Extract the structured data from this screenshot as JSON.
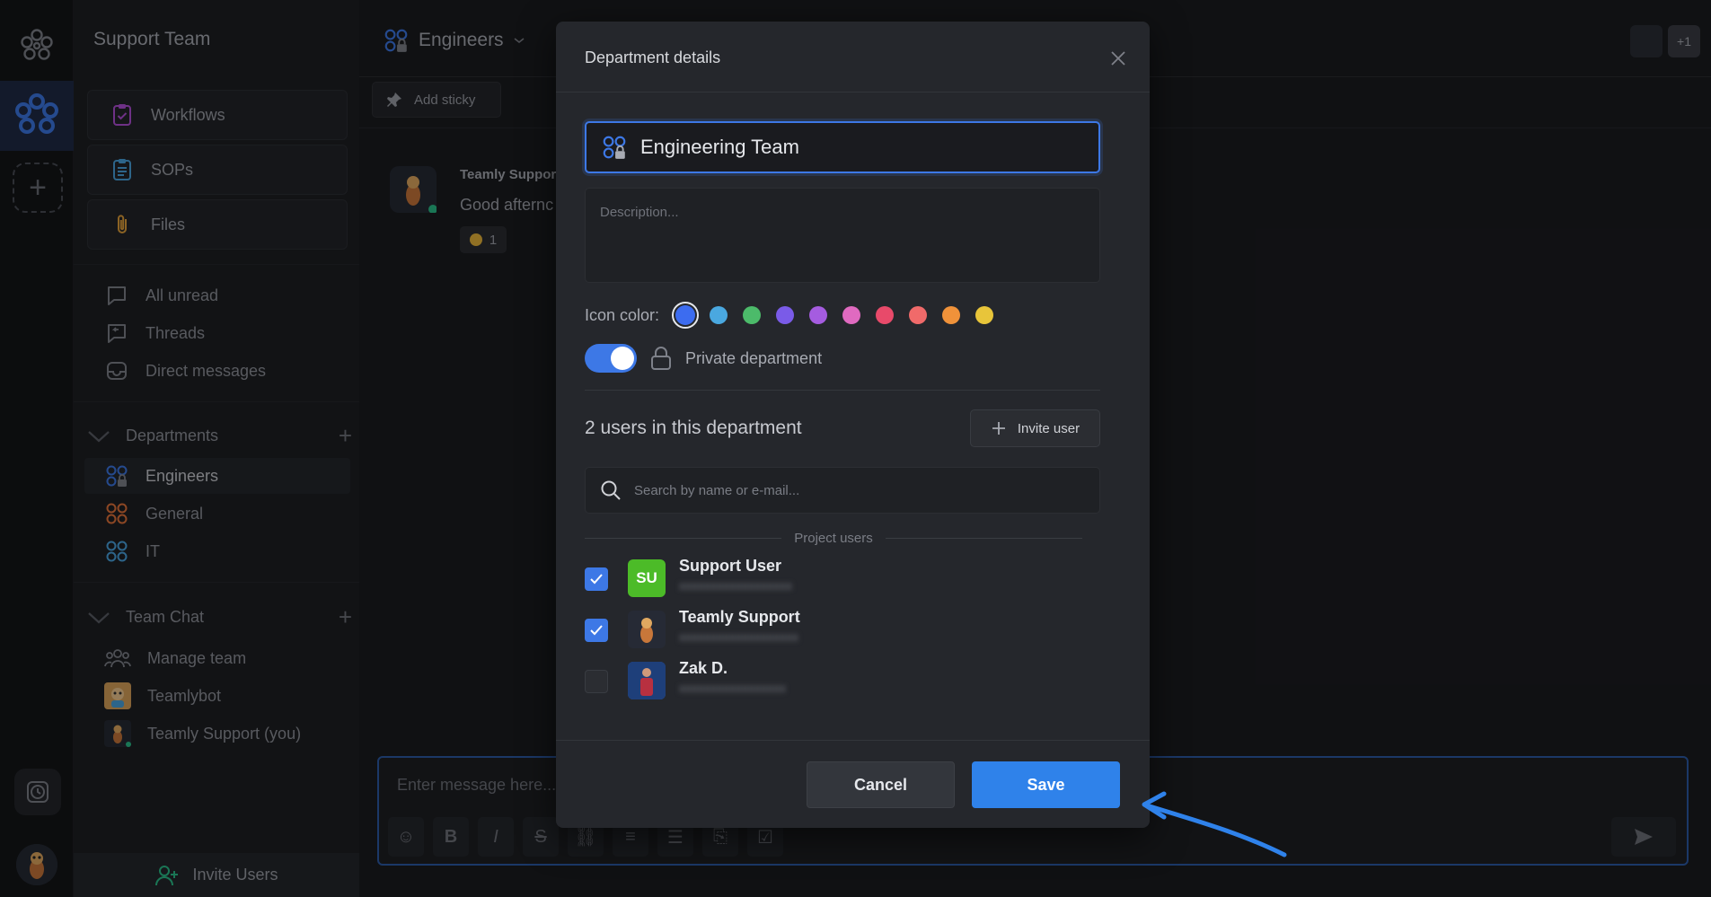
{
  "workspace": {
    "name": "Support Team"
  },
  "sidebar": {
    "cards": [
      {
        "label": "Workflows",
        "icon": "clipboard-check-icon"
      },
      {
        "label": "SOPs",
        "icon": "clipboard-list-icon"
      },
      {
        "label": "Files",
        "icon": "paperclip-icon"
      }
    ],
    "nav": [
      {
        "label": "All unread",
        "icon": "chat-bubble-icon"
      },
      {
        "label": "Threads",
        "icon": "threads-icon"
      },
      {
        "label": "Direct messages",
        "icon": "inbox-icon"
      }
    ],
    "departments_label": "Departments",
    "departments": [
      {
        "label": "Engineers",
        "color": "#3d78e6"
      },
      {
        "label": "General",
        "color": "#e2733a"
      },
      {
        "label": "IT",
        "color": "#4aa3df"
      }
    ],
    "team_chat_label": "Team Chat",
    "team_chat": [
      {
        "label": "Manage team"
      },
      {
        "label": "Teamlybot"
      },
      {
        "label": "Teamly Support (you)"
      }
    ],
    "invite_users": "Invite Users"
  },
  "channel": {
    "name": "Engineers",
    "add_sticky": "Add sticky",
    "message": {
      "author": "Teamly Suppor",
      "text": "Good afternc",
      "reaction_count": "1"
    },
    "composer_placeholder": "Enter message here...",
    "participants_extra": "+1"
  },
  "modal": {
    "title": "Department details",
    "name_value": "Engineering Team",
    "description_placeholder": "Description...",
    "icon_color_label": "Icon color:",
    "colors": [
      "#3c6cf0",
      "#4aa8e0",
      "#4cbb6a",
      "#7a5be8",
      "#a55ce0",
      "#e06ac0",
      "#e84a6a",
      "#f06a6a",
      "#f0923a",
      "#e8c53a"
    ],
    "selected_color": "#3c6cf0",
    "private_label": "Private department",
    "private_on": true,
    "users_count_label": "2 users in this department",
    "invite_user_label": "Invite user",
    "search_placeholder": "Search by name or e-mail...",
    "project_users_label": "Project users",
    "users": [
      {
        "name": "Support User",
        "initials": "SU",
        "checked": true,
        "avatar_color": "#4cbb28"
      },
      {
        "name": "Teamly Support",
        "initials": "",
        "checked": true,
        "avatar_color": "#262a35"
      },
      {
        "name": "Zak D.",
        "initials": "",
        "checked": false,
        "avatar_color": "#2a5fb8"
      }
    ],
    "cancel_label": "Cancel",
    "save_label": "Save"
  }
}
